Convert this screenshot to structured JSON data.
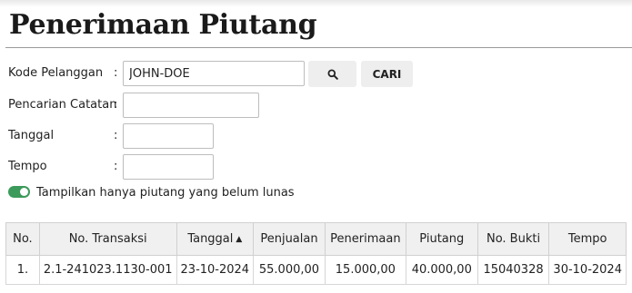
{
  "page": {
    "title": "Penerimaan Piutang"
  },
  "form": {
    "kode_pelanggan": {
      "label": "Kode Pelanggan",
      "value": "JOHN-DOE"
    },
    "pencarian_catatan": {
      "label": "Pencarian Catatan",
      "value": ""
    },
    "tanggal": {
      "label": "Tanggal",
      "value": ""
    },
    "tempo": {
      "label": "Tempo",
      "value": ""
    },
    "colon": ":",
    "search_icon": "search-icon",
    "cari_label": "CARI",
    "toggle": {
      "label": "Tampilkan hanya piutang yang belum lunas",
      "checked": true,
      "color": "#3c9a5a"
    }
  },
  "table": {
    "columns": [
      "No.",
      "No. Transaksi",
      "Tanggal",
      "Penjualan",
      "Penerimaan",
      "Piutang",
      "No. Bukti",
      "Tempo"
    ],
    "sort_indicator": "^",
    "rows": [
      [
        "1.",
        "2.1-241023.1130-001",
        "23-10-2024",
        "55.000,00",
        "15.000,00",
        "40.000,00",
        "15040328",
        "30-10-2024"
      ]
    ]
  }
}
